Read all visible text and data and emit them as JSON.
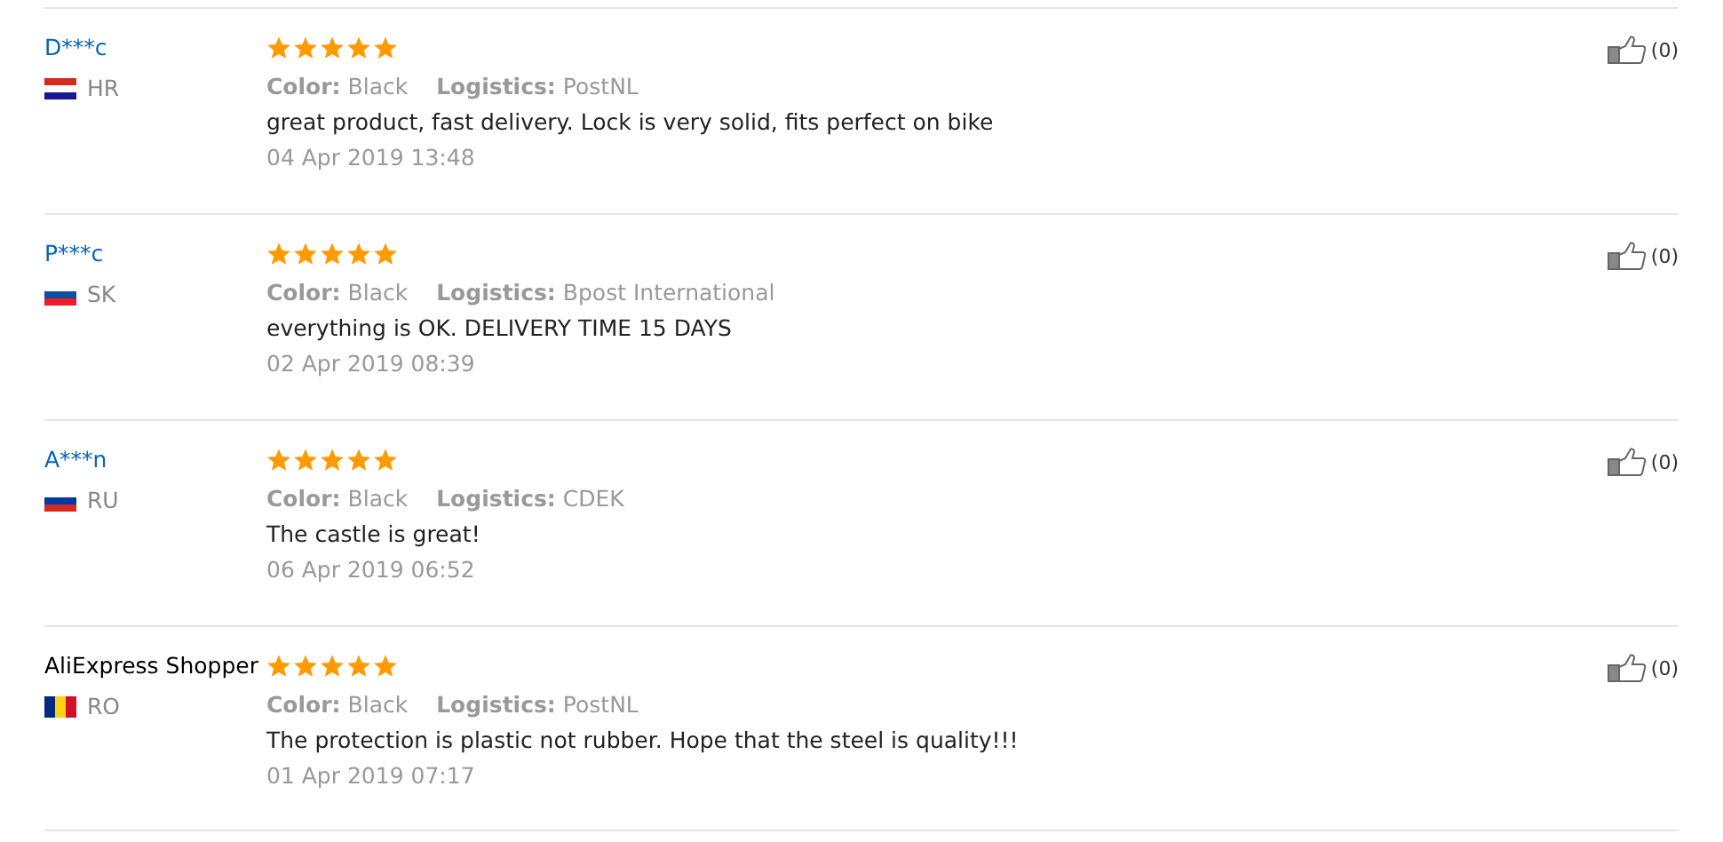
{
  "reviews": [
    {
      "name": "D***c",
      "link": true,
      "country": "HR",
      "stars": 5,
      "color_label": "Color:",
      "color_value": "Black",
      "logistics_label": "Logistics:",
      "logistics_value": "PostNL",
      "text": "great product, fast delivery. Lock is very solid, fits perfect on bike",
      "date": "04 Apr 2019 13:48",
      "likes": "(0)"
    },
    {
      "name": "P***c",
      "link": true,
      "country": "SK",
      "stars": 5,
      "color_label": "Color:",
      "color_value": "Black",
      "logistics_label": "Logistics:",
      "logistics_value": "Bpost International",
      "text": "everything is OK. DELIVERY TIME 15 DAYS",
      "date": "02 Apr 2019 08:39",
      "likes": "(0)"
    },
    {
      "name": "A***n",
      "link": true,
      "country": "RU",
      "stars": 5,
      "color_label": "Color:",
      "color_value": "Black",
      "logistics_label": "Logistics:",
      "logistics_value": "CDEK",
      "text": "The castle is great!",
      "date": "06 Apr 2019 06:52",
      "likes": "(0)"
    },
    {
      "name": "AliExpress Shopper",
      "link": false,
      "country": "RO",
      "stars": 5,
      "color_label": "Color:",
      "color_value": "Black",
      "logistics_label": "Logistics:",
      "logistics_value": "PostNL",
      "text": "The protection is plastic not rubber. Hope that the steel is quality!!!",
      "date": "01 Apr 2019 07:17",
      "likes": "(0)"
    }
  ]
}
